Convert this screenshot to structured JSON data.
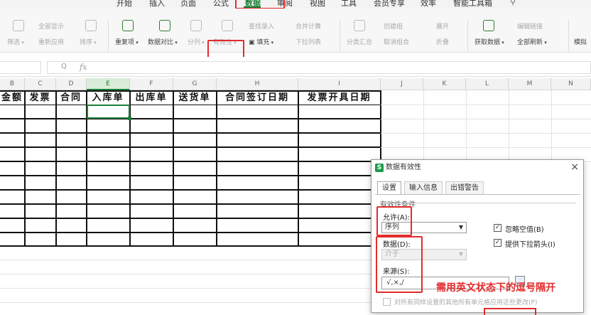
{
  "menu": {
    "tabs": [
      "开始",
      "插入",
      "页面",
      "公式",
      "数据",
      "审阅",
      "视图",
      "工具",
      "会员专享",
      "效率",
      "智能工具箱"
    ],
    "active_tab": "数据"
  },
  "ribbon": {
    "filter": "筛选",
    "show_all": "全部显示",
    "reapply": "重新应用",
    "sort": "排序",
    "duplicates": "重复项",
    "compare": "数据对比",
    "split": "分列",
    "validity": "有效性",
    "fill": "填充",
    "find_entry": "查找录入",
    "merge_calc": "合并计算",
    "dropdown_list": "下拉列表",
    "group_summary": "分类汇总",
    "create_group": "创建组",
    "ungroup": "取消组合",
    "expand": "展开",
    "collapse": "折叠",
    "get_data": "获取数据",
    "edit_links": "编辑链接",
    "refresh_all": "全部刷新",
    "simulate": "模拟"
  },
  "formula_bar": {
    "fx": "fx",
    "zoom": "Q"
  },
  "columns": [
    "B",
    "C",
    "D",
    "E",
    "F",
    "G",
    "H",
    "I",
    "J",
    "K",
    "L",
    "M",
    "N"
  ],
  "header_row": [
    "金额",
    "发票",
    "合同",
    "入库单",
    "出库单",
    "送货单",
    "合同签订日期",
    "发票开具日期"
  ],
  "dialog": {
    "title": "数据有效性",
    "logo": "S",
    "close": "×",
    "tabs": [
      "设置",
      "输入信息",
      "出错警告"
    ],
    "section": "有效性条件",
    "allow_label": "允许(A):",
    "allow_value": "序列",
    "data_label": "数据(D):",
    "data_value": "介于",
    "source_label": "来源(S):",
    "source_value": "√,×,/",
    "ignore_blank": "忽略空值(B)",
    "dropdown_arrow": "提供下拉箭头(I)",
    "apply_all": "对所有同样设置的其他所有单元格应用这些更改(P)"
  },
  "annotation": "需用英文状态下的逗号隔开",
  "colors": {
    "accent": "#1a7f37",
    "annotation": "#e32b2b"
  }
}
